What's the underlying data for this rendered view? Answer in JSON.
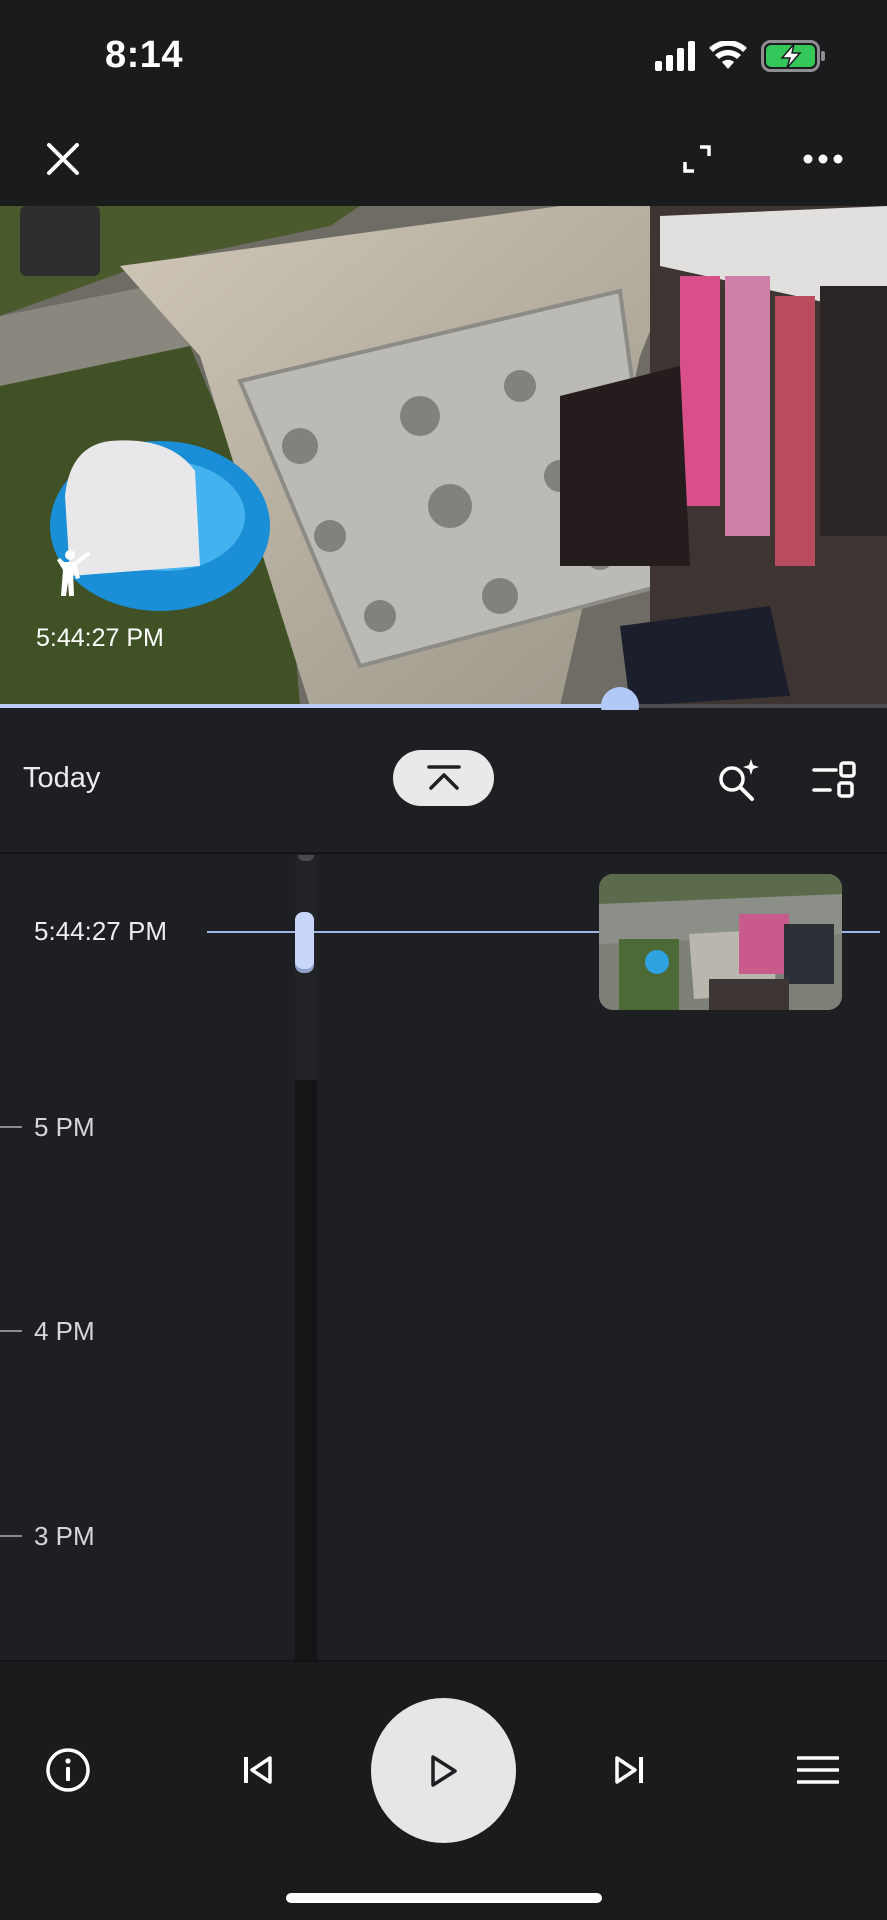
{
  "status_bar": {
    "time": "8:14",
    "icons": [
      "signal-icon",
      "wifi-icon",
      "battery-charging-icon"
    ],
    "battery_color": "#34c759"
  },
  "top_bar": {
    "icons": [
      "close-icon",
      "fullscreen-icon",
      "more-options-icon"
    ]
  },
  "player": {
    "event_time": "5:44:27 PM",
    "event_icon": "person-icon",
    "progress_fraction": 0.7,
    "accent_color": "#b2c8f6"
  },
  "header": {
    "date_label": "Today",
    "collapse_icon": "collapse-up-icon",
    "actions": [
      "search-sparkle-icon",
      "filter-icon"
    ]
  },
  "timeline": {
    "current_time": "5:44:27 PM",
    "hours": [
      "5 PM",
      "4 PM",
      "3 PM"
    ]
  },
  "controls": {
    "icons": [
      "info-icon",
      "previous-event-icon",
      "play-icon",
      "next-event-icon",
      "menu-icon"
    ]
  }
}
